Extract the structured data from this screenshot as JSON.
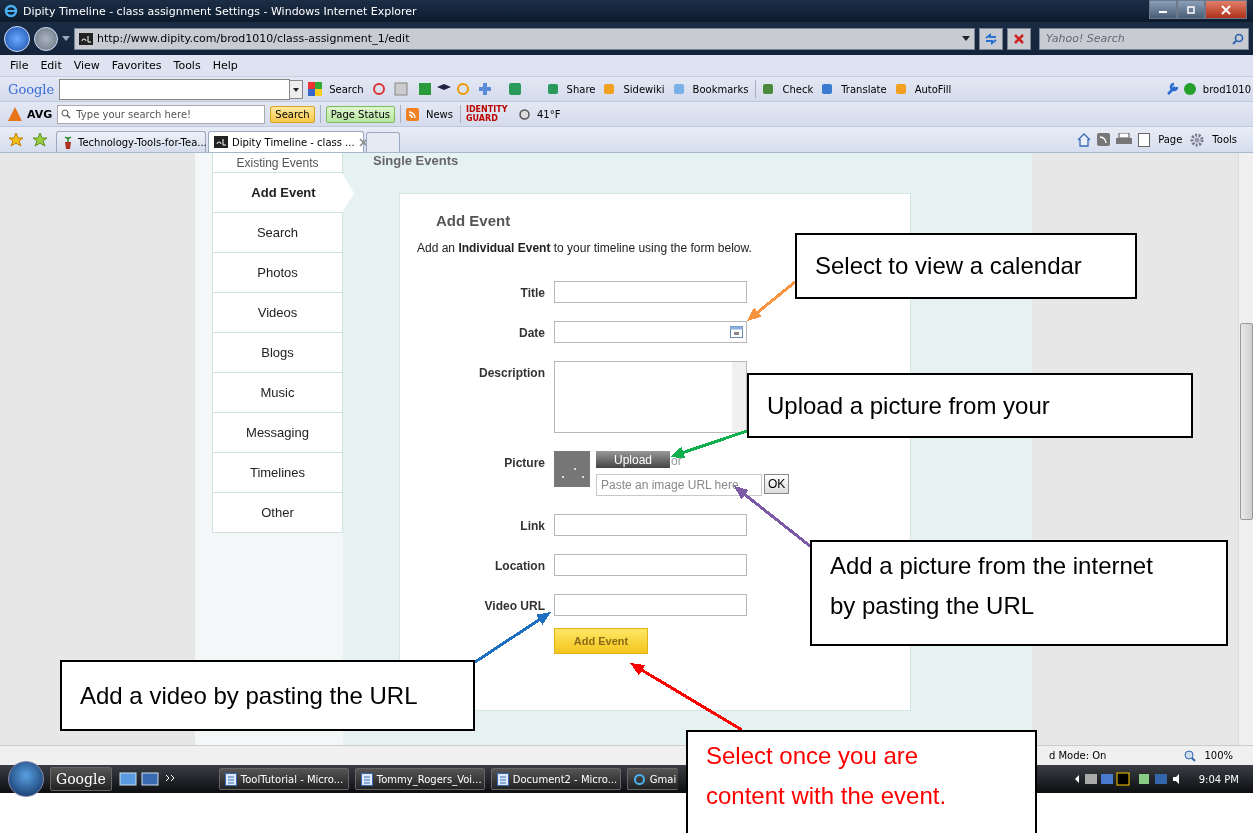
{
  "window": {
    "title": "Dipity Timeline - class assignment Settings - Windows Internet Explorer"
  },
  "address_bar": {
    "url": "http://www.dipity.com/brod1010/class-assignment_1/edit",
    "search_placeholder": "Yahoo! Search"
  },
  "menu": [
    "File",
    "Edit",
    "View",
    "Favorites",
    "Tools",
    "Help"
  ],
  "google_toolbar": {
    "brand": "Google",
    "search": "Search",
    "items": [
      "Share",
      "Sidewiki",
      "Bookmarks",
      "Check",
      "Translate",
      "AutoFill"
    ],
    "user": "brod1010"
  },
  "avg_toolbar": {
    "brand": "AVG",
    "search_placeholder": "Type your search here!",
    "search": "Search",
    "page_status": "Page Status",
    "news": "News",
    "identity": "IDENTITY GUARD",
    "weather": "41°F"
  },
  "tabs": [
    {
      "label": "Technology-Tools-for-Tea...",
      "selected": false
    },
    {
      "label": "Dipity Timeline - class ...",
      "selected": true
    }
  ],
  "command_bar": [
    "Page",
    "Tools"
  ],
  "sidebar": [
    {
      "label": "Existing Events",
      "selected": false
    },
    {
      "label": "Add Event",
      "selected": true
    },
    {
      "label": "Search",
      "selected": false
    },
    {
      "label": "Photos",
      "selected": false
    },
    {
      "label": "Videos",
      "selected": false
    },
    {
      "label": "Blogs",
      "selected": false
    },
    {
      "label": "Music",
      "selected": false
    },
    {
      "label": "Messaging",
      "selected": false
    },
    {
      "label": "Timelines",
      "selected": false
    },
    {
      "label": "Other",
      "selected": false
    }
  ],
  "main": {
    "section_title": "Single Events",
    "form_title": "Add Event",
    "intro": "Add an **Individual Event** to your timeline using the form below.",
    "fields": [
      {
        "label": "Title",
        "kind": "text"
      },
      {
        "label": "Date",
        "kind": "date"
      },
      {
        "label": "Description",
        "kind": "textarea"
      },
      {
        "label": "Picture",
        "kind": "picture",
        "upload": "Upload",
        "or": "or",
        "placeholder": "Paste an image URL here",
        "ok": "OK"
      },
      {
        "label": "Link",
        "kind": "text"
      },
      {
        "label": "Location",
        "kind": "text"
      },
      {
        "label": "Video URL",
        "kind": "text"
      }
    ],
    "submit": "Add Event"
  },
  "status_bar": {
    "zone": "d Mode: On",
    "zoom": "100%"
  },
  "taskbar": {
    "google": "Google",
    "buttons": [
      "ToolTutorial - Micro...",
      "Tommy_Rogers_Voi...",
      "Document2 - Micro...",
      "Gmai"
    ],
    "clock": "9:04 PM"
  },
  "callouts": [
    {
      "text": "Select to view a calendar",
      "color": "#f7943f",
      "emphasis": false
    },
    {
      "text": "Upload a picture from your",
      "color": "#0eaf4c",
      "emphasis": false
    },
    {
      "text": "Add a picture from the internet by pasting the URL",
      "color": "#7c5aa8",
      "emphasis": false
    },
    {
      "text": "Add a video by pasting the URL",
      "color": "#1d6fc2",
      "emphasis": false
    },
    {
      "text": "Select once you are content with the event.",
      "color": "#ff0000",
      "emphasis": true
    }
  ]
}
